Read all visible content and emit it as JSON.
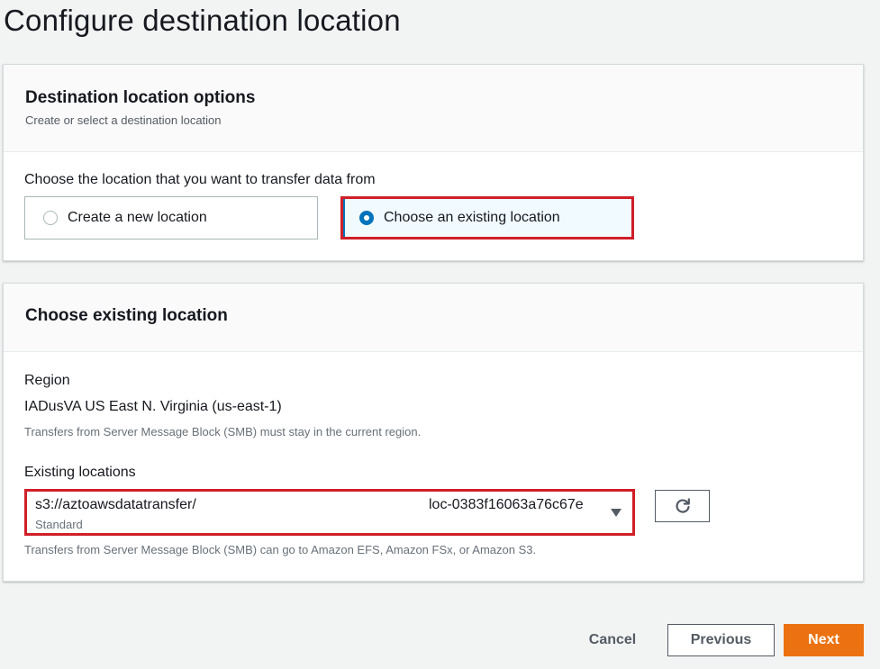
{
  "page": {
    "title": "Configure destination location"
  },
  "destination_options": {
    "title": "Destination location options",
    "description": "Create or select a destination location",
    "choose_label": "Choose the location that you want to transfer data from",
    "options": [
      {
        "label": "Create a new location",
        "selected": false
      },
      {
        "label": "Choose an existing location",
        "selected": true
      }
    ]
  },
  "existing_location": {
    "title": "Choose existing location",
    "region_label": "Region",
    "region_value": "IADusVA US East N. Virginia (us-east-1)",
    "region_hint": "Transfers from Server Message Block (SMB) must stay in the current region.",
    "existing_label": "Existing locations",
    "selected": {
      "path": "s3://aztoawsdatatransfer/",
      "storage_class": "Standard",
      "location_id": "loc-0383f16063a76c67e"
    },
    "select_hint": "Transfers from Server Message Block (SMB) can go to Amazon EFS, Amazon FSx, or Amazon S3."
  },
  "footer": {
    "cancel_label": "Cancel",
    "previous_label": "Previous",
    "next_label": "Next"
  },
  "colors": {
    "accent": "#0073bb",
    "highlight": "#d01f28",
    "primary_button": "#ec7211"
  }
}
